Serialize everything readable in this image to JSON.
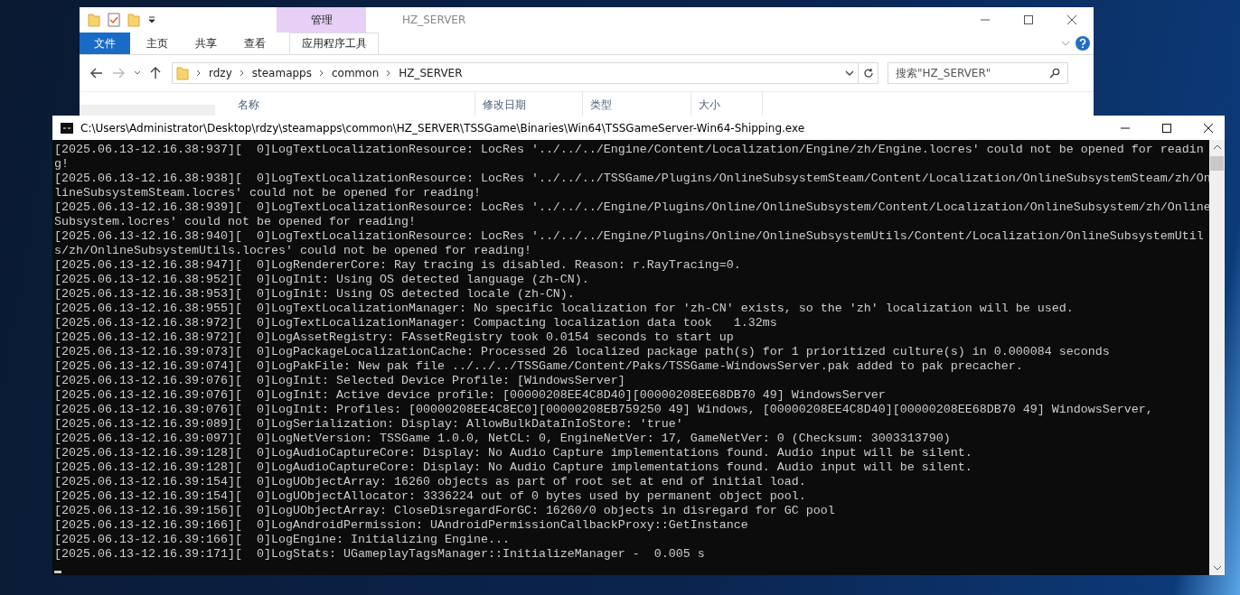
{
  "explorer": {
    "title": "HZ_SERVER",
    "context_tab": "管理",
    "ribbon_tabs": [
      {
        "label": "文件",
        "kind": "file",
        "selected": false
      },
      {
        "label": "主页",
        "kind": "tab",
        "selected": false
      },
      {
        "label": "共享",
        "kind": "tab",
        "selected": false
      },
      {
        "label": "查看",
        "kind": "tab",
        "selected": false
      },
      {
        "label": "应用程序工具",
        "kind": "context",
        "selected": false
      }
    ],
    "breadcrumbs": [
      "rdzy",
      "steamapps",
      "common",
      "HZ_SERVER"
    ],
    "search": {
      "placeholder": "搜索\"HZ_SERVER\""
    },
    "columns": [
      "名称",
      "修改日期",
      "类型",
      "大小"
    ]
  },
  "console": {
    "title": "C:\\Users\\Administrator\\Desktop\\rdzy\\steamapps\\common\\HZ_SERVER\\TSSGame\\Binaries\\Win64\\TSSGameServer-Win64-Shipping.exe",
    "lines": [
      "[2025.06.13-12.16.38:937][  0]LogTextLocalizationResource: LocRes '../../../Engine/Content/Localization/Engine/zh/Engine.locres' could not be opened for reading!",
      "[2025.06.13-12.16.38:938][  0]LogTextLocalizationResource: LocRes '../../../TSSGame/Plugins/OnlineSubsystemSteam/Content/Localization/OnlineSubsystemSteam/zh/OnlineSubsystemSteam.locres' could not be opened for reading!",
      "[2025.06.13-12.16.38:939][  0]LogTextLocalizationResource: LocRes '../../../Engine/Plugins/Online/OnlineSubsystem/Content/Localization/OnlineSubsystem/zh/OnlineSubsystem.locres' could not be opened for reading!",
      "[2025.06.13-12.16.38:940][  0]LogTextLocalizationResource: LocRes '../../../Engine/Plugins/Online/OnlineSubsystemUtils/Content/Localization/OnlineSubsystemUtils/zh/OnlineSubsystemUtils.locres' could not be opened for reading!",
      "[2025.06.13-12.16.38:947][  0]LogRendererCore: Ray tracing is disabled. Reason: r.RayTracing=0.",
      "[2025.06.13-12.16.38:952][  0]LogInit: Using OS detected language (zh-CN).",
      "[2025.06.13-12.16.38:953][  0]LogInit: Using OS detected locale (zh-CN).",
      "[2025.06.13-12.16.38:955][  0]LogTextLocalizationManager: No specific localization for 'zh-CN' exists, so the 'zh' localization will be used.",
      "[2025.06.13-12.16.38:972][  0]LogTextLocalizationManager: Compacting localization data took   1.32ms",
      "[2025.06.13-12.16.38:972][  0]LogAssetRegistry: FAssetRegistry took 0.0154 seconds to start up",
      "[2025.06.13-12.16.39:073][  0]LogPackageLocalizationCache: Processed 26 localized package path(s) for 1 prioritized culture(s) in 0.000084 seconds",
      "[2025.06.13-12.16.39:074][  0]LogPakFile: New pak file ../../../TSSGame/Content/Paks/TSSGame-WindowsServer.pak added to pak precacher.",
      "[2025.06.13-12.16.39:076][  0]LogInit: Selected Device Profile: [WindowsServer]",
      "[2025.06.13-12.16.39:076][  0]LogInit: Active device profile: [00000208EE4C8D40][00000208EE68DB70 49] WindowsServer",
      "[2025.06.13-12.16.39:076][  0]LogInit: Profiles: [00000208EE4C8EC0][00000208EB759250 49] Windows, [00000208EE4C8D40][00000208EE68DB70 49] WindowsServer,",
      "[2025.06.13-12.16.39:089][  0]LogSerialization: Display: AllowBulkDataInIoStore: 'true'",
      "[2025.06.13-12.16.39:097][  0]LogNetVersion: TSSGame 1.0.0, NetCL: 0, EngineNetVer: 17, GameNetVer: 0 (Checksum: 3003313790)",
      "[2025.06.13-12.16.39:128][  0]LogAudioCaptureCore: Display: No Audio Capture implementations found. Audio input will be silent.",
      "[2025.06.13-12.16.39:128][  0]LogAudioCaptureCore: Display: No Audio Capture implementations found. Audio input will be silent.",
      "[2025.06.13-12.16.39:154][  0]LogUObjectArray: 16260 objects as part of root set at end of initial load.",
      "[2025.06.13-12.16.39:154][  0]LogUObjectAllocator: 3336224 out of 0 bytes used by permanent object pool.",
      "[2025.06.13-12.16.39:156][  0]LogUObjectArray: CloseDisregardForGC: 16260/0 objects in disregard for GC pool",
      "[2025.06.13-12.16.39:166][  0]LogAndroidPermission: UAndroidPermissionCallbackProxy::GetInstance",
      "[2025.06.13-12.16.39:166][  0]LogEngine: Initializing Engine...",
      "[2025.06.13-12.16.39:171][  0]LogStats: UGameplayTagsManager::InitializeManager -  0.005 s"
    ]
  }
}
